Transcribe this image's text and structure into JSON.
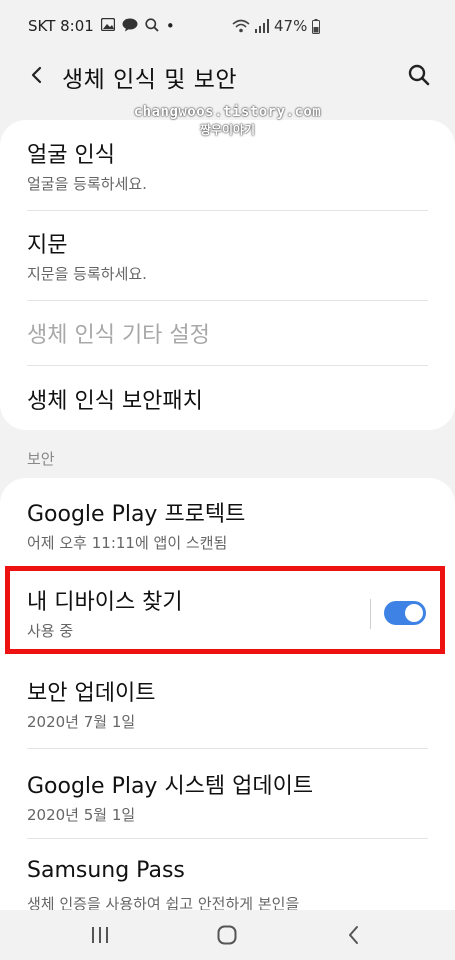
{
  "status_bar": {
    "carrier_time": "SKT 8:01",
    "dot": "•",
    "battery": "47%",
    "icons": [
      "gallery-icon",
      "talk-icon",
      "search-icon",
      "wifi-icon",
      "signal-icon",
      "battery-icon"
    ]
  },
  "header": {
    "title": "생체 인식 및 보안",
    "back_icon": "chevron-left-icon",
    "search_icon": "search-icon"
  },
  "watermark": {
    "url": "changwoos.tistory.com",
    "name": "짱우이야기"
  },
  "biometrics": [
    {
      "title": "얼굴 인식",
      "subtitle": "얼굴을 등록하세요."
    },
    {
      "title": "지문",
      "subtitle": "지문을 등록하세요."
    },
    {
      "title": "생체 인식 기타 설정",
      "subtitle": ""
    },
    {
      "title": "생체 인식 보안패치",
      "subtitle": ""
    }
  ],
  "security_section_label": "보안",
  "security": [
    {
      "title": "Google Play 프로텍트",
      "subtitle": "어제 오후 11:11에 앱이 스캔됨"
    },
    {
      "title": "내 디바이스 찾기",
      "subtitle": "사용 중",
      "toggle_on": true
    },
    {
      "title": "보안 업데이트",
      "subtitle": "2020년 7월 1일"
    },
    {
      "title": "Google Play 시스템 업데이트",
      "subtitle": "2020년 5월 1일"
    },
    {
      "title": "Samsung Pass",
      "subtitle": "생체 인증을 사용하여 쉽고 안전하게 본인을"
    }
  ],
  "colors": {
    "accent": "#3e82e5",
    "highlight": "#ee1111",
    "background": "#f2f2f2"
  },
  "nav_bar": {
    "icons": [
      "recent-apps-icon",
      "home-icon",
      "back-icon"
    ]
  }
}
